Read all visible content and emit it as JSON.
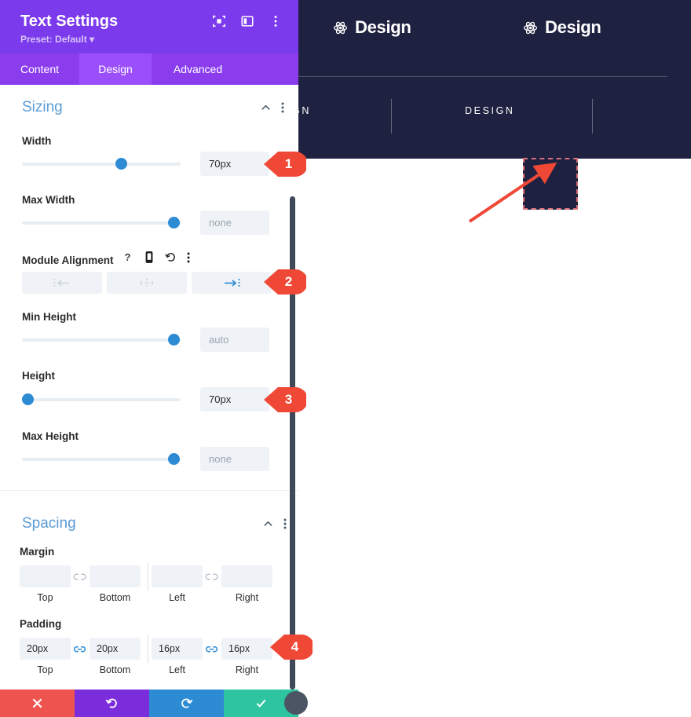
{
  "panel": {
    "title": "Text Settings",
    "preset": "Preset: Default",
    "header_icons": [
      {
        "name": "focus-target-icon"
      },
      {
        "name": "layout-panel-icon"
      },
      {
        "name": "more-vertical-icon"
      }
    ],
    "tabs": [
      {
        "label": "Content",
        "active": false
      },
      {
        "label": "Design",
        "active": true
      },
      {
        "label": "Advanced",
        "active": false
      }
    ]
  },
  "sizing": {
    "title": "Sizing",
    "fields": {
      "width": {
        "label": "Width",
        "value": "70px",
        "slider_pct": 62
      },
      "max_width": {
        "label": "Max Width",
        "value": "",
        "placeholder": "none",
        "slider_pct": 97
      },
      "module_alignment": {
        "label": "Module Alignment",
        "options": [
          {
            "name": "align-left",
            "active": false
          },
          {
            "name": "align-center",
            "active": false
          },
          {
            "name": "align-right",
            "active": true
          }
        ]
      },
      "min_height": {
        "label": "Min Height",
        "value": "",
        "placeholder": "auto",
        "slider_pct": 97
      },
      "height": {
        "label": "Height",
        "value": "70px",
        "slider_pct": 2
      },
      "max_height": {
        "label": "Max Height",
        "value": "",
        "placeholder": "none",
        "slider_pct": 97
      }
    }
  },
  "spacing": {
    "title": "Spacing",
    "margin": {
      "label": "Margin",
      "values": [
        "",
        "",
        "",
        ""
      ],
      "captions": [
        "Top",
        "Bottom",
        "Left",
        "Right"
      ],
      "linked": false
    },
    "padding": {
      "label": "Padding",
      "values": [
        "20px",
        "20px",
        "16px",
        "16px"
      ],
      "captions": [
        "Top",
        "Bottom",
        "Left",
        "Right"
      ],
      "linked": true
    }
  },
  "bottom_bar": [
    {
      "name": "cancel-button",
      "icon": "close-icon",
      "color": "#ef5350"
    },
    {
      "name": "undo-button",
      "icon": "undo-icon",
      "color": "#7c2ddb"
    },
    {
      "name": "redo-button",
      "icon": "redo-icon",
      "color": "#2d8bd4"
    },
    {
      "name": "save-button",
      "icon": "check-icon",
      "color": "#2ec4a0"
    }
  ],
  "callouts": [
    {
      "number": "1"
    },
    {
      "number": "2"
    },
    {
      "number": "3"
    },
    {
      "number": "4"
    }
  ],
  "preview": {
    "logos": [
      "Design",
      "Design"
    ],
    "nav_items": [
      "GN",
      "DESIGN"
    ],
    "module_label": ""
  },
  "colors": {
    "panel_purple": "#7c3aed",
    "tab_bar": "#8b3dee",
    "accent_blue": "#2d8bd4",
    "section_title": "#5b9bd5",
    "callout_red": "#ef4836",
    "preview_navy": "#1e2240",
    "dashed_border": "#d96f7a"
  }
}
